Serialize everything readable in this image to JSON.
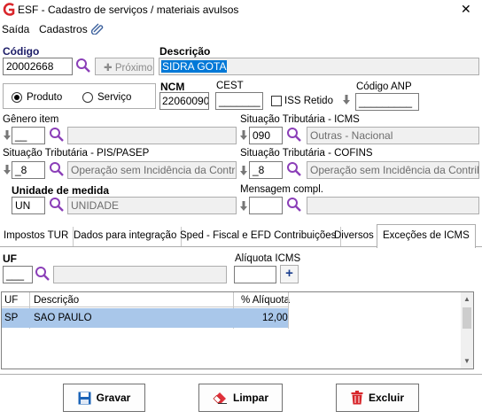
{
  "window": {
    "title": "ESF - Cadastro de serviços / materiais avulsos",
    "close": "✕"
  },
  "menu": {
    "items": [
      "Saída",
      "Cadastros"
    ]
  },
  "form": {
    "codigo_label": "Código",
    "codigo_value": "20002668",
    "proximo_label": "Próximo",
    "descricao_label": "Descrição",
    "descricao_value": "SIDRA GOTA",
    "tipo_produto": "Produto",
    "tipo_servico": "Serviço",
    "tipo_selected": "Produto",
    "ncm_label": "NCM",
    "ncm_value": "22060090",
    "cest_label": "CEST",
    "cest_value": "_______",
    "iss_label": "ISS Retido",
    "iss_checked": false,
    "anp_label": "Código ANP",
    "anp_value": "_________",
    "genero_label": "Gênero item",
    "genero_value": "__",
    "genero_desc": "",
    "icms_label": "Situação Tributária - ICMS",
    "icms_value": "090",
    "icms_desc": "Outras - Nacional",
    "pis_label": "Situação Tributária - PIS/PASEP",
    "pis_value": "_8",
    "pis_desc": "Operação sem Incidência da Contribuiç",
    "cofins_label": "Situação Tributária - COFINS",
    "cofins_value": "_8",
    "cofins_desc": "Operação sem Incidência da Contribuiç",
    "unidade_label": "Unidade de medida",
    "unidade_value": "UN",
    "unidade_desc": "UNIDADE",
    "msg_label": "Mensagem compl.",
    "msg_value": "",
    "msg_desc": ""
  },
  "tabs": [
    "Impostos TUR",
    "Dados para integração",
    "Sped - Fiscal e EFD Contribuições",
    "Diversos",
    "Exceções de ICMS"
  ],
  "active_tab": "Exceções de ICMS",
  "excecoes": {
    "uf_label": "UF",
    "uf_value": "___",
    "aliquota_label": "Alíquota ICMS",
    "aliquota_value": "",
    "add_symbol": "+",
    "table": {
      "headers": [
        "UF",
        "Descrição",
        "% Alíquota"
      ],
      "rows": [
        {
          "uf": "SP",
          "descricao": "SAO PAULO",
          "aliquota": "12,00"
        }
      ]
    }
  },
  "buttons": {
    "gravar": "Gravar",
    "limpar": "Limpar",
    "excluir": "Excluir"
  },
  "colors": {
    "accent": "#0078d7",
    "selection_row": "#a9c7ea",
    "icon_purple": "#8b3fb8",
    "logo_red": "#d9262b",
    "excluir_red": "#d7262b",
    "gravar_blue": "#1b64b8"
  }
}
